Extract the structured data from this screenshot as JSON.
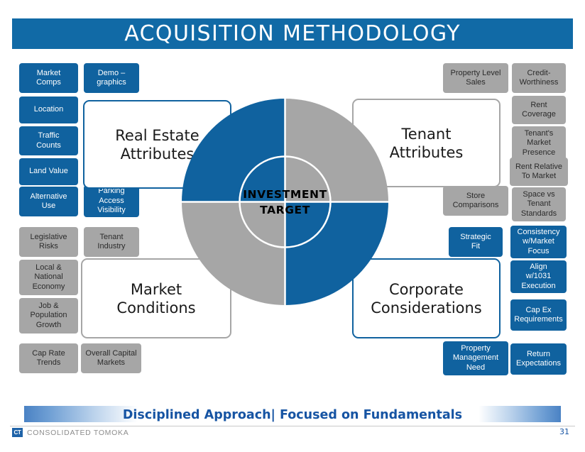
{
  "slide": {
    "title": "ACQUISITION METHODOLOGY",
    "page_number": "31"
  },
  "colors": {
    "blue": "#10629F",
    "title_blue": "#116AA6",
    "gray": "#A6A6A6",
    "tagline_blue": "#1654A3"
  },
  "center": {
    "line1": "INVESTMENT",
    "line2": "TARGET"
  },
  "quadrants": {
    "top_left": {
      "label": "Real Estate\nAttributes",
      "line1": "Real Estate",
      "line2": "Attributes",
      "color": "blue"
    },
    "top_right": {
      "label": "Tenant\nAttributes",
      "line1": "Tenant",
      "line2": "Attributes",
      "color": "gray"
    },
    "bottom_left": {
      "label": "Market\nConditions",
      "line1": "Market",
      "line2": "Conditions",
      "color": "gray"
    },
    "bottom_right": {
      "label": "Corporate\nConsiderations",
      "line1": "Corporate",
      "line2": "Considerations",
      "color": "blue"
    }
  },
  "chips": {
    "real_estate_attributes": [
      {
        "id": "market-comps",
        "lines": [
          "Market",
          "Comps"
        ],
        "style": "blue"
      },
      {
        "id": "demographics",
        "lines": [
          "Demo –",
          "graphics"
        ],
        "style": "blue"
      },
      {
        "id": "location",
        "lines": [
          "Location"
        ],
        "style": "blue"
      },
      {
        "id": "traffic-counts",
        "lines": [
          "Traffic",
          "Counts"
        ],
        "style": "blue"
      },
      {
        "id": "land-value",
        "lines": [
          "Land Value"
        ],
        "style": "blue"
      },
      {
        "id": "alternative-use",
        "lines": [
          "Alternative",
          "Use"
        ],
        "style": "blue"
      },
      {
        "id": "parking-access-visibility",
        "lines": [
          "Parking",
          "Access",
          "Visibility"
        ],
        "style": "blue"
      }
    ],
    "market_conditions": [
      {
        "id": "legislative-risks",
        "lines": [
          "Legislative",
          "Risks"
        ],
        "style": "gray"
      },
      {
        "id": "tenant-industry",
        "lines": [
          "Tenant",
          "Industry"
        ],
        "style": "gray"
      },
      {
        "id": "local-national-economy",
        "lines": [
          "Local &",
          "National",
          "Economy"
        ],
        "style": "gray"
      },
      {
        "id": "job-population-growth",
        "lines": [
          "Job &",
          "Population",
          "Growth"
        ],
        "style": "gray"
      },
      {
        "id": "cap-rate-trends",
        "lines": [
          "Cap Rate",
          "Trends"
        ],
        "style": "gray"
      },
      {
        "id": "overall-capital-markets",
        "lines": [
          "Overall Capital",
          "Markets"
        ],
        "style": "gray"
      }
    ],
    "tenant_attributes": [
      {
        "id": "property-level-sales",
        "lines": [
          "Property Level",
          "Sales"
        ],
        "style": "gray"
      },
      {
        "id": "credit-worthiness",
        "lines": [
          "Credit-",
          "Worthiness"
        ],
        "style": "gray"
      },
      {
        "id": "rent-coverage",
        "lines": [
          "Rent",
          "Coverage"
        ],
        "style": "gray"
      },
      {
        "id": "tenants-market-presence",
        "lines": [
          "Tenant's",
          "Market",
          "Presence"
        ],
        "style": "gray"
      },
      {
        "id": "rent-relative-to-market",
        "lines": [
          "Rent Relative",
          "To Market"
        ],
        "style": "gray"
      },
      {
        "id": "store-comparisons",
        "lines": [
          "Store",
          "Comparisons"
        ],
        "style": "gray"
      },
      {
        "id": "space-vs-tenant-standards",
        "lines": [
          "Space vs",
          "Tenant",
          "Standards"
        ],
        "style": "gray"
      }
    ],
    "corporate_considerations": [
      {
        "id": "strategic-fit",
        "lines": [
          "Strategic",
          "Fit"
        ],
        "style": "blue"
      },
      {
        "id": "consistency-w-market-focus",
        "lines": [
          "Consistency",
          "w/Market",
          "Focus"
        ],
        "style": "blue"
      },
      {
        "id": "align-w-1031-execution",
        "lines": [
          "Align",
          "w/1031",
          "Execution"
        ],
        "style": "blue"
      },
      {
        "id": "cap-ex-requirements",
        "lines": [
          "Cap Ex",
          "Requirements"
        ],
        "style": "blue"
      },
      {
        "id": "property-management-need",
        "lines": [
          "Property",
          "Management",
          "Need"
        ],
        "style": "blue"
      },
      {
        "id": "return-expectations",
        "lines": [
          "Return",
          "Expectations"
        ],
        "style": "blue"
      }
    ]
  },
  "footer": {
    "tagline": "Disciplined Approach|  Focused on Fundamentals",
    "brand_mark": "CT",
    "brand_name": "CONSOLIDATED TOMOKA"
  }
}
